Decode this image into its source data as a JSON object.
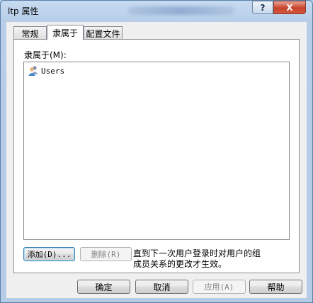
{
  "window": {
    "title": "ltp 属性",
    "help_label": "?",
    "close_label": "X"
  },
  "tabs": [
    {
      "label": "常规"
    },
    {
      "label": "隶属于"
    },
    {
      "label": "配置文件"
    }
  ],
  "member_of": {
    "label": "隶属于(M):",
    "items": [
      {
        "name": "Users",
        "icon": "user-group-icon"
      }
    ],
    "add_button": "添加(D)...",
    "remove_button": "删除(R)",
    "note": "直到下一次用户登录时对用户的组成员关系的更改才生效。"
  },
  "footer": {
    "ok": "确定",
    "cancel": "取消",
    "apply": "应用(A)",
    "help": "帮助"
  }
}
